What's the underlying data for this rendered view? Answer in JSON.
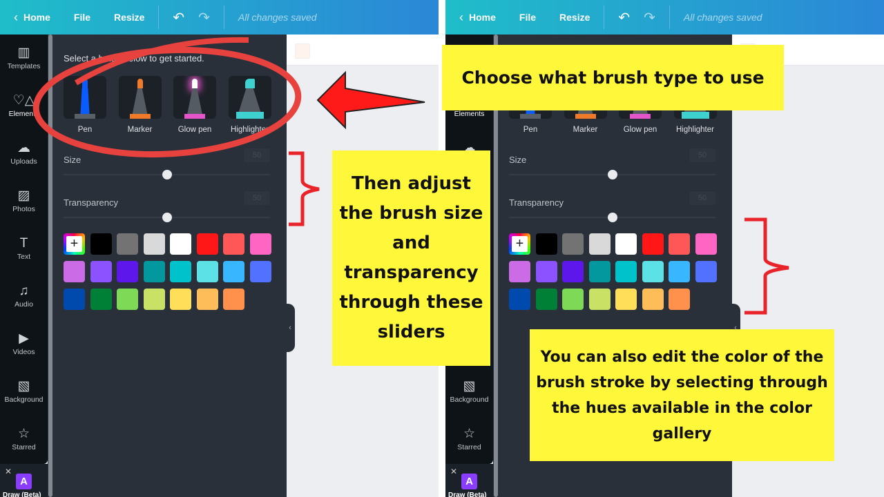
{
  "topbar": {
    "home": "Home",
    "file": "File",
    "resize": "Resize",
    "status": "All changes saved",
    "undo_icon": "undo-icon",
    "redo_icon": "redo-icon"
  },
  "sidebar": {
    "items": [
      {
        "label": "Templates",
        "icon": "▥"
      },
      {
        "label": "Elements",
        "icon": "♡△"
      },
      {
        "label": "Uploads",
        "icon": "☁"
      },
      {
        "label": "Photos",
        "icon": "▨"
      },
      {
        "label": "Text",
        "icon": "T"
      },
      {
        "label": "Audio",
        "icon": "♫"
      },
      {
        "label": "Videos",
        "icon": "▶"
      },
      {
        "label": "Background",
        "icon": "▧"
      },
      {
        "label": "Starred",
        "icon": "☆"
      }
    ],
    "app": {
      "label": "Draw (Beta)",
      "letter": "A"
    }
  },
  "panel": {
    "title": "Select a brush below to get started.",
    "brushes": [
      {
        "label": "Pen",
        "color": "#0a5cff"
      },
      {
        "label": "Marker",
        "color": "#f07a2a"
      },
      {
        "label": "Glow pen",
        "color": "#e455c9"
      },
      {
        "label": "Highlighter",
        "color": "#3fd0d0"
      }
    ],
    "size": {
      "label": "Size",
      "value": "50",
      "percent": 50
    },
    "transparency": {
      "label": "Transparency",
      "value": "50",
      "percent": 50
    },
    "add_color": "+",
    "colors": [
      "#000000",
      "#737373",
      "#d9d9d9",
      "#ffffff",
      "#ff1616",
      "#ff5757",
      "#ff66c4",
      "#cb6ce6",
      "#8c52ff",
      "#5e17eb",
      "#03989e",
      "#00c2cb",
      "#5ce1e6",
      "#38b6ff",
      "#5271ff",
      "#004aad",
      "#008037",
      "#7ed957",
      "#c9e265",
      "#ffde59",
      "#ffbd59",
      "#ff914d"
    ]
  },
  "annotations": {
    "brush_type": "Choose what brush type to use",
    "sliders": "Then adjust the brush size and transparency through these sliders",
    "colors": "You can also edit the color of the brush stroke by selecting through the hues available in the color gallery",
    "accent": "#e8232a",
    "note_color": "#fff83a"
  }
}
